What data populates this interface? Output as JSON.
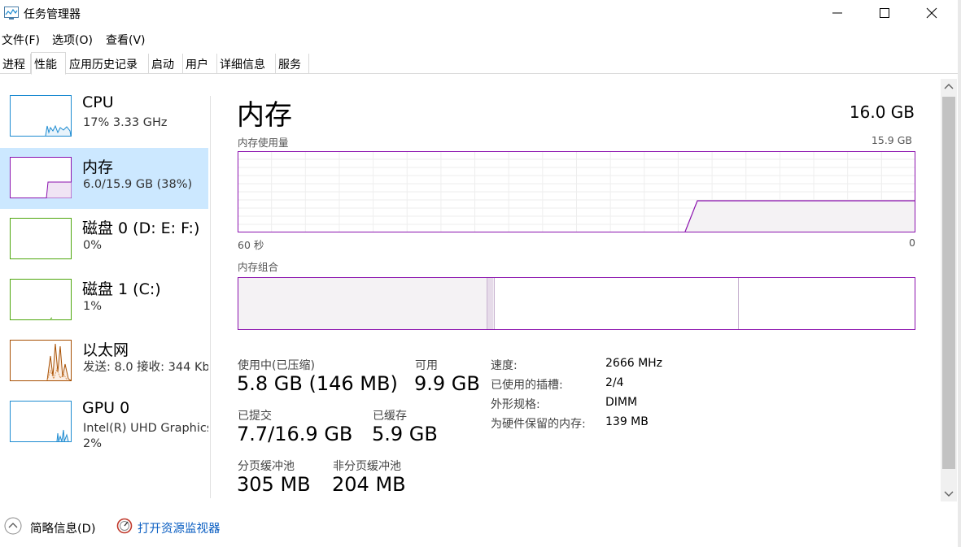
{
  "window": {
    "title": "任务管理器",
    "controls": {
      "minimize": "minimize-icon",
      "maximize": "maximize-icon",
      "close": "close-icon"
    }
  },
  "menu": [
    "文件(F)",
    "选项(O)",
    "查看(V)"
  ],
  "tabs": [
    {
      "label": "进程",
      "active": false
    },
    {
      "label": "性能",
      "active": true
    },
    {
      "label": "应用历史记录",
      "active": false
    },
    {
      "label": "启动",
      "active": false
    },
    {
      "label": "用户",
      "active": false
    },
    {
      "label": "详细信息",
      "active": false
    },
    {
      "label": "服务",
      "active": false
    }
  ],
  "devices": [
    {
      "name": "CPU",
      "sub": "17% 3.33 GHz",
      "color": "#1d8bd1",
      "selected": false
    },
    {
      "name": "内存",
      "sub": "6.0/15.9 GB (38%)",
      "color": "#8b12ae",
      "selected": true
    },
    {
      "name": "磁盘 0 (D: E: F:)",
      "sub": "0%",
      "color": "#4da60c",
      "selected": false
    },
    {
      "name": "磁盘 1 (C:)",
      "sub": "1%",
      "color": "#4da60c",
      "selected": false
    },
    {
      "name": "以太网",
      "sub": "发送: 8.0 接收: 344 Kb",
      "color": "#a74f01",
      "selected": false
    },
    {
      "name": "GPU 0",
      "sub": "Intel(R) UHD Graphics",
      "sub2": "2%",
      "color": "#1d8bd1",
      "selected": false
    }
  ],
  "main": {
    "title": "内存",
    "total": "16.0 GB",
    "usage_label": "内存使用量",
    "usage_max": "15.9 GB",
    "time_left": "60 秒",
    "time_right": "0",
    "composition_label": "内存组合",
    "accent": "#8b12ae",
    "fill": "#f4f2f4"
  },
  "stats": {
    "in_use": {
      "label": "使用中(已压缩)",
      "value": "5.8 GB (146 MB)"
    },
    "available": {
      "label": "可用",
      "value": "9.9 GB"
    },
    "committed": {
      "label": "已提交",
      "value": "7.7/16.9 GB"
    },
    "cached": {
      "label": "已缓存",
      "value": "5.9 GB"
    },
    "paged": {
      "label": "分页缓冲池",
      "value": "305 MB"
    },
    "nonpaged": {
      "label": "非分页缓冲池",
      "value": "204 MB"
    }
  },
  "properties": [
    {
      "label": "速度:",
      "value": "2666 MHz"
    },
    {
      "label": "已使用的插槽:",
      "value": "2/4"
    },
    {
      "label": "外形规格:",
      "value": "DIMM"
    },
    {
      "label": "为硬件保留的内存:",
      "value": "139 MB"
    }
  ],
  "footer": {
    "fewer_details": "简略信息(D)",
    "open_monitor": "打开资源监视器"
  }
}
